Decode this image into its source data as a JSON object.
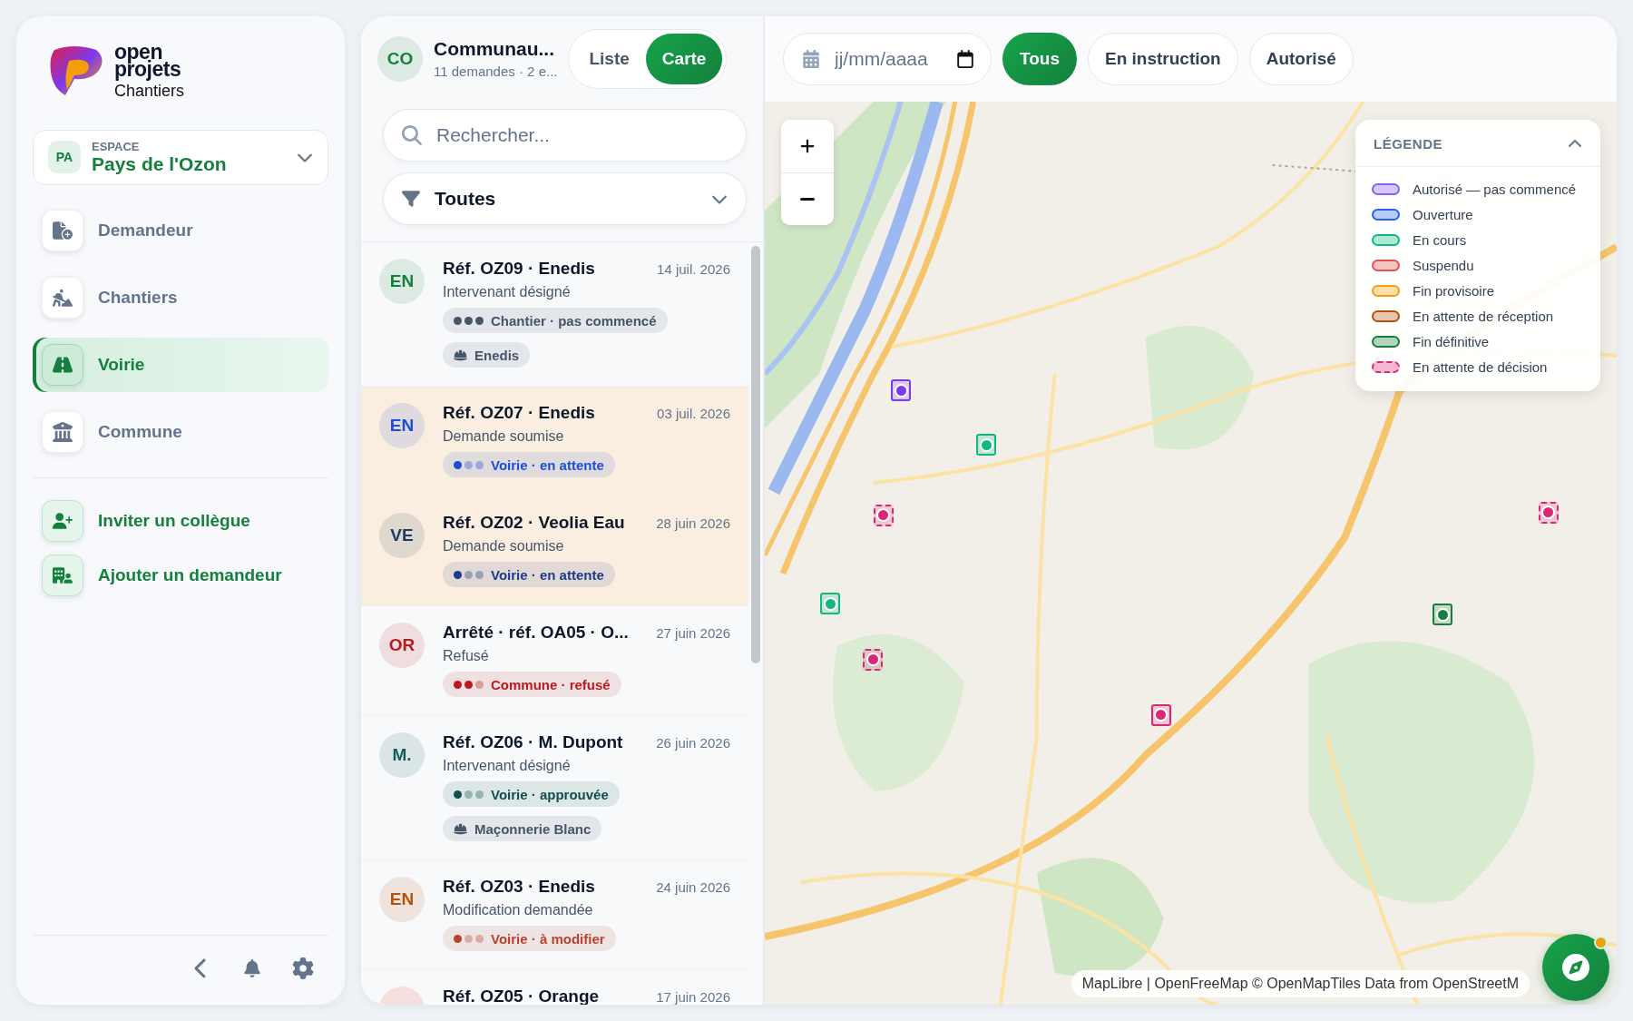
{
  "brand": {
    "name": "open projets",
    "product": "Chantiers"
  },
  "workspace": {
    "initials": "PA",
    "label": "ESPACE",
    "name": "Pays de l'Ozon"
  },
  "nav": [
    {
      "label": "Demandeur",
      "selected": false
    },
    {
      "label": "Chantiers",
      "selected": false
    },
    {
      "label": "Voirie",
      "selected": true
    },
    {
      "label": "Commune",
      "selected": false
    }
  ],
  "actions": [
    {
      "label": "Inviter un collègue"
    },
    {
      "label": "Ajouter un demandeur"
    }
  ],
  "list_header": {
    "initials": "CO",
    "title": "Communau...",
    "subtitle": "11 demandes · 2 e..."
  },
  "view_toggle": [
    {
      "label": "Liste",
      "selected": false
    },
    {
      "label": "Carte",
      "selected": true
    }
  ],
  "search": {
    "placeholder": "Rechercher..."
  },
  "filter": {
    "value": "Toutes"
  },
  "requests": [
    {
      "initials": "EN",
      "color": "#15803d",
      "title": "Réf. OZ09 · Enedis",
      "date": "14 juil. 2026",
      "status": "Intervenant désigné",
      "highlighted": false,
      "tags": [
        {
          "kind": "status",
          "label": "Chantier · pas commencé",
          "color": "#475569",
          "dots": [
            {
              "filled": true
            },
            {
              "filled": true
            },
            {
              "filled": true
            }
          ]
        },
        {
          "kind": "company",
          "label": "Enedis"
        }
      ]
    },
    {
      "initials": "EN",
      "color": "#1d4ed8",
      "title": "Réf. OZ07 · Enedis",
      "date": "03 juil. 2026",
      "status": "Demande soumise",
      "highlighted": true,
      "tags": [
        {
          "kind": "status",
          "label": "Voirie · en attente",
          "color": "#1d4ed8",
          "dots": [
            {
              "filled": true
            },
            {
              "filled": false
            },
            {
              "filled": false
            }
          ]
        }
      ]
    },
    {
      "initials": "VE",
      "color": "#1e3a5f",
      "title": "Réf. OZ02 · Veolia Eau",
      "date": "28 juin 2026",
      "status": "Demande soumise",
      "highlighted": true,
      "tags": [
        {
          "kind": "status",
          "label": "Voirie · en attente",
          "color": "#1e3a8a",
          "dots": [
            {
              "filled": true
            },
            {
              "filled": false
            },
            {
              "filled": false
            }
          ]
        }
      ]
    },
    {
      "initials": "OR",
      "color": "#b91c1c",
      "title": "Arrêté · réf. OA05 · O...",
      "date": "27 juin 2026",
      "status": "Refusé",
      "highlighted": false,
      "tags": [
        {
          "kind": "status",
          "label": "Commune · refusé",
          "color": "#b91c1c",
          "dots": [
            {
              "filled": true
            },
            {
              "filled": true
            },
            {
              "filled": false
            }
          ]
        }
      ]
    },
    {
      "initials": "M.",
      "color": "#115e59",
      "title": "Réf. OZ06 · M. Dupont",
      "date": "26 juin 2026",
      "status": "Intervenant désigné",
      "highlighted": false,
      "tags": [
        {
          "kind": "status",
          "label": "Voirie · approuvée",
          "color": "#134e4a",
          "dots": [
            {
              "filled": true
            },
            {
              "filled": false
            },
            {
              "filled": false
            }
          ]
        },
        {
          "kind": "company",
          "label": "Maçonnerie Blanc"
        }
      ]
    },
    {
      "initials": "EN",
      "color": "#b45309",
      "title": "Réf. OZ03 · Enedis",
      "date": "24 juin 2026",
      "status": "Modification demandée",
      "highlighted": false,
      "tags": [
        {
          "kind": "status",
          "label": "Voirie · à modifier",
          "color": "#b4442d",
          "dots": [
            {
              "filled": true
            },
            {
              "filled": false
            },
            {
              "filled": false
            }
          ]
        }
      ]
    },
    {
      "title": "Réf. OZ05 · Orange",
      "date": "17 juin 2026",
      "highlighted": false
    }
  ],
  "date_filter": {
    "placeholder": "jj/mm/aaaa"
  },
  "status_chips": [
    {
      "label": "Tous",
      "selected": true
    },
    {
      "label": "En instruction",
      "selected": false
    },
    {
      "label": "Autorisé",
      "selected": false
    }
  ],
  "legend": {
    "title": "LÉGENDE",
    "expanded": true,
    "items": [
      {
        "label": "Autorisé — pas commencé",
        "color": "#8b5cf6",
        "kind": "solid"
      },
      {
        "label": "Ouverture",
        "color": "#2563eb",
        "kind": "solid"
      },
      {
        "label": "En cours",
        "color": "#10b981",
        "kind": "solid"
      },
      {
        "label": "Suspendu",
        "color": "#e05252",
        "kind": "solid"
      },
      {
        "label": "Fin provisoire",
        "color": "#f59e0b",
        "kind": "solid"
      },
      {
        "label": "En attente de réception",
        "color": "#b45309",
        "kind": "solid"
      },
      {
        "label": "Fin définitive",
        "color": "#15803d",
        "kind": "solid"
      },
      {
        "label": "En attente de décision",
        "color": "#db2777",
        "kind": "dashed"
      }
    ]
  },
  "markers": [
    {
      "color": "#7c3aed",
      "kind": "solid"
    },
    {
      "color": "#10b981",
      "kind": "solid"
    },
    {
      "color": "#db2777",
      "kind": "dashed"
    },
    {
      "color": "#10b981",
      "kind": "solid"
    },
    {
      "color": "#db2777",
      "kind": "dashed"
    },
    {
      "color": "#db2777",
      "kind": "solid"
    },
    {
      "color": "#15803d",
      "kind": "solid"
    },
    {
      "color": "#db2777",
      "kind": "dashed"
    }
  ],
  "attribution": "MapLibre | OpenFreeMap © OpenMapTiles Data from OpenStreetM"
}
